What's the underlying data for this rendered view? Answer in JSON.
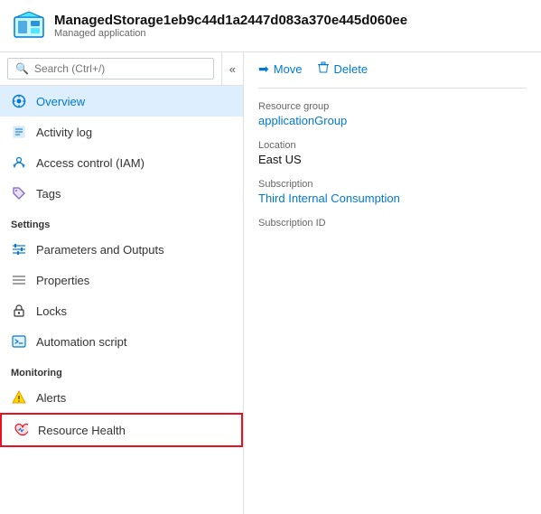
{
  "header": {
    "title": "ManagedStorage1eb9c44d1a2447d083a370e445d060ee",
    "subtitle": "Managed application"
  },
  "search": {
    "placeholder": "Search (Ctrl+/)"
  },
  "collapse_label": "«",
  "nav": {
    "top_items": [
      {
        "id": "overview",
        "label": "Overview",
        "active": true
      },
      {
        "id": "activity-log",
        "label": "Activity log",
        "active": false
      },
      {
        "id": "access-control",
        "label": "Access control (IAM)",
        "active": false
      },
      {
        "id": "tags",
        "label": "Tags",
        "active": false
      }
    ],
    "sections": [
      {
        "label": "Settings",
        "items": [
          {
            "id": "parameters-outputs",
            "label": "Parameters and Outputs"
          },
          {
            "id": "properties",
            "label": "Properties"
          },
          {
            "id": "locks",
            "label": "Locks"
          },
          {
            "id": "automation-script",
            "label": "Automation script"
          }
        ]
      },
      {
        "label": "Monitoring",
        "items": [
          {
            "id": "alerts",
            "label": "Alerts"
          },
          {
            "id": "resource-health",
            "label": "Resource Health",
            "highlighted": true
          }
        ]
      }
    ]
  },
  "toolbar": {
    "move_label": "Move",
    "delete_label": "Delete"
  },
  "details": {
    "resource_group_label": "Resource group",
    "resource_group_value": "applicationGroup",
    "location_label": "Location",
    "location_value": "East US",
    "subscription_label": "Subscription",
    "subscription_value": "Third Internal Consumption",
    "subscription_id_label": "Subscription ID",
    "subscription_id_value": ""
  },
  "colors": {
    "accent": "#0078d4",
    "active_bg": "#ddeeff",
    "highlight_border": "#e81123"
  }
}
